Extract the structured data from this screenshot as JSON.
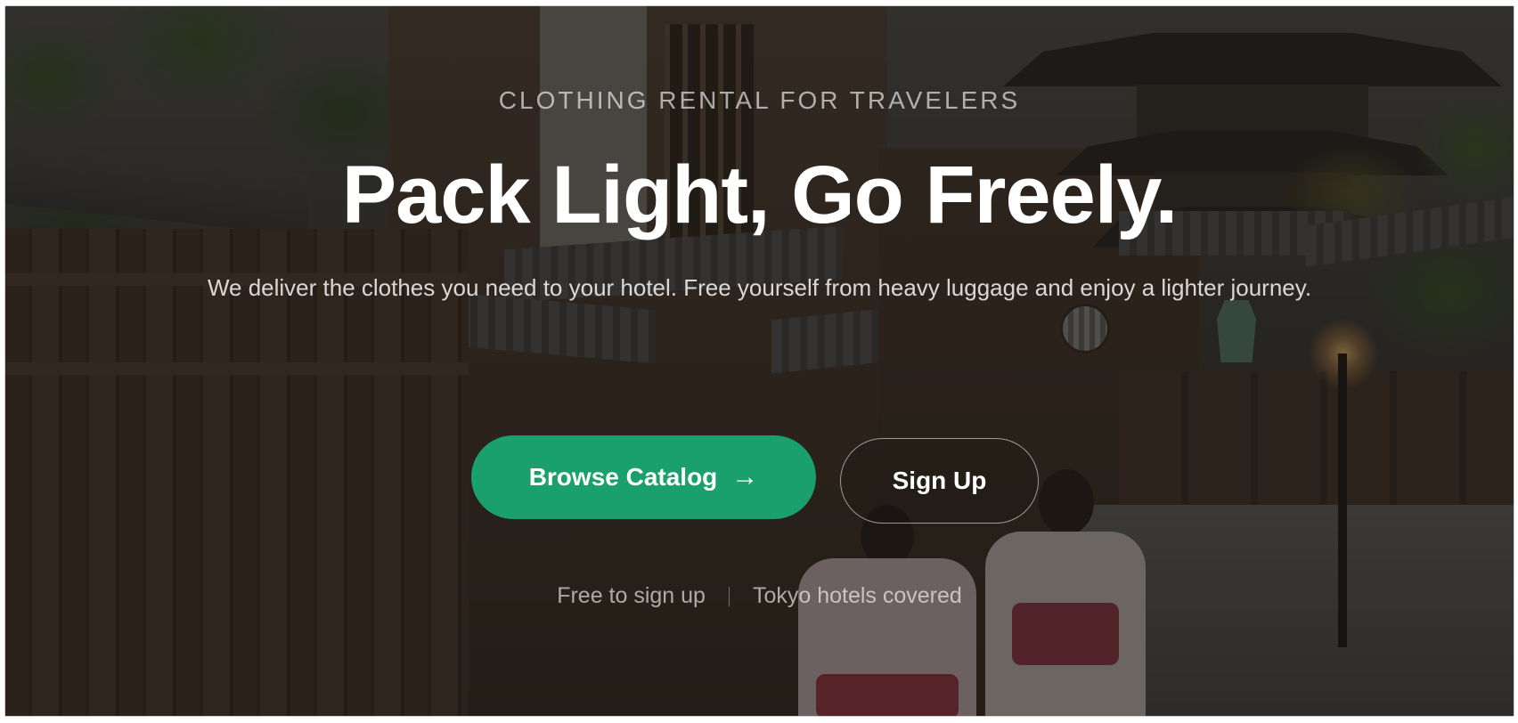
{
  "hero": {
    "eyebrow": "CLOTHING RENTAL FOR TRAVELERS",
    "headline": "Pack Light, Go Freely.",
    "subtitle": "We deliver the clothes you need to your hotel. Free yourself from heavy luggage and enjoy a lighter journey.",
    "primary_button": {
      "label": "Browse Catalog",
      "icon": "arrow-right-icon",
      "color": "#1aa06d"
    },
    "secondary_button": {
      "label": "Sign Up"
    },
    "footnotes": [
      "Free to sign up",
      "Tokyo hotels covered"
    ]
  },
  "background": {
    "image": "kyoto-street-pagoda-photo",
    "overlay_color": "#12100e"
  }
}
